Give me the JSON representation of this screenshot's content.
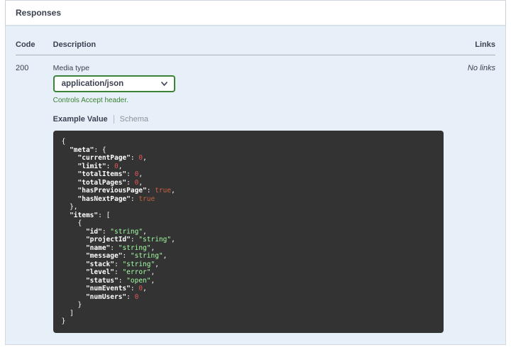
{
  "section": {
    "title": "Responses"
  },
  "table": {
    "headers": {
      "code": "Code",
      "description": "Description",
      "links": "Links"
    }
  },
  "response": {
    "code": "200",
    "links": "No links",
    "media_type_label": "Media type",
    "media_type_selected": "application/json",
    "controls_note": "Controls Accept header.",
    "tabs": {
      "example": "Example Value",
      "schema": "Schema"
    }
  },
  "colors": {
    "accent-green": "#3c8238",
    "note-green": "#3b8132",
    "panel-blue": "#e7f0f9",
    "text": "#3b4151",
    "code-bg": "#333333",
    "code-key": "#ffffff",
    "code-string": "#a2fca2",
    "code-number": "#e0565c",
    "code-boolean": "#c8623c"
  },
  "code_block": {
    "lines": [
      [
        [
          "p",
          "{"
        ]
      ],
      [
        [
          "p",
          "  "
        ],
        [
          "k",
          "\"meta\""
        ],
        [
          "p",
          ": {"
        ]
      ],
      [
        [
          "p",
          "    "
        ],
        [
          "k",
          "\"currentPage\""
        ],
        [
          "p",
          ": "
        ],
        [
          "n",
          "0"
        ],
        [
          "p",
          ","
        ]
      ],
      [
        [
          "p",
          "    "
        ],
        [
          "k",
          "\"limit\""
        ],
        [
          "p",
          ": "
        ],
        [
          "n",
          "0"
        ],
        [
          "p",
          ","
        ]
      ],
      [
        [
          "p",
          "    "
        ],
        [
          "k",
          "\"totalItems\""
        ],
        [
          "p",
          ": "
        ],
        [
          "n",
          "0"
        ],
        [
          "p",
          ","
        ]
      ],
      [
        [
          "p",
          "    "
        ],
        [
          "k",
          "\"totalPages\""
        ],
        [
          "p",
          ": "
        ],
        [
          "n",
          "0"
        ],
        [
          "p",
          ","
        ]
      ],
      [
        [
          "p",
          "    "
        ],
        [
          "k",
          "\"hasPreviousPage\""
        ],
        [
          "p",
          ": "
        ],
        [
          "b",
          "true"
        ],
        [
          "p",
          ","
        ]
      ],
      [
        [
          "p",
          "    "
        ],
        [
          "k",
          "\"hasNextPage\""
        ],
        [
          "p",
          ": "
        ],
        [
          "b",
          "true"
        ]
      ],
      [
        [
          "p",
          "  },"
        ]
      ],
      [
        [
          "p",
          "  "
        ],
        [
          "k",
          "\"items\""
        ],
        [
          "p",
          ": ["
        ]
      ],
      [
        [
          "p",
          "    {"
        ]
      ],
      [
        [
          "p",
          "      "
        ],
        [
          "k",
          "\"id\""
        ],
        [
          "p",
          ": "
        ],
        [
          "s",
          "\"string\""
        ],
        [
          "p",
          ","
        ]
      ],
      [
        [
          "p",
          "      "
        ],
        [
          "k",
          "\"projectId\""
        ],
        [
          "p",
          ": "
        ],
        [
          "s",
          "\"string\""
        ],
        [
          "p",
          ","
        ]
      ],
      [
        [
          "p",
          "      "
        ],
        [
          "k",
          "\"name\""
        ],
        [
          "p",
          ": "
        ],
        [
          "s",
          "\"string\""
        ],
        [
          "p",
          ","
        ]
      ],
      [
        [
          "p",
          "      "
        ],
        [
          "k",
          "\"message\""
        ],
        [
          "p",
          ": "
        ],
        [
          "s",
          "\"string\""
        ],
        [
          "p",
          ","
        ]
      ],
      [
        [
          "p",
          "      "
        ],
        [
          "k",
          "\"stack\""
        ],
        [
          "p",
          ": "
        ],
        [
          "s",
          "\"string\""
        ],
        [
          "p",
          ","
        ]
      ],
      [
        [
          "p",
          "      "
        ],
        [
          "k",
          "\"level\""
        ],
        [
          "p",
          ": "
        ],
        [
          "s",
          "\"error\""
        ],
        [
          "p",
          ","
        ]
      ],
      [
        [
          "p",
          "      "
        ],
        [
          "k",
          "\"status\""
        ],
        [
          "p",
          ": "
        ],
        [
          "s",
          "\"open\""
        ],
        [
          "p",
          ","
        ]
      ],
      [
        [
          "p",
          "      "
        ],
        [
          "k",
          "\"numEvents\""
        ],
        [
          "p",
          ": "
        ],
        [
          "n",
          "0"
        ],
        [
          "p",
          ","
        ]
      ],
      [
        [
          "p",
          "      "
        ],
        [
          "k",
          "\"numUsers\""
        ],
        [
          "p",
          ": "
        ],
        [
          "n",
          "0"
        ]
      ],
      [
        [
          "p",
          "    }"
        ]
      ],
      [
        [
          "p",
          "  ]"
        ]
      ],
      [
        [
          "p",
          "}"
        ]
      ]
    ]
  }
}
